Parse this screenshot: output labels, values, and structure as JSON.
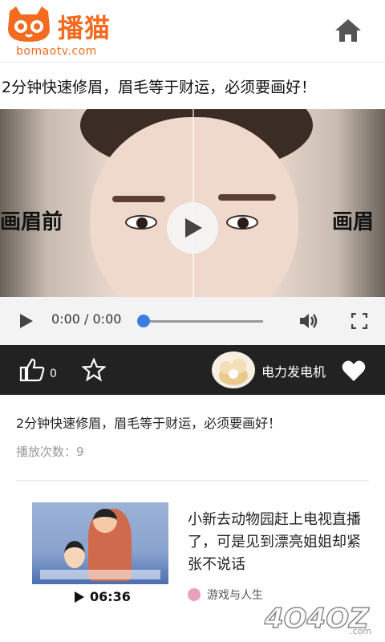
{
  "header": {
    "logo_cn": "播猫",
    "logo_url": "bomaotv.com",
    "home_icon": "home-icon"
  },
  "video": {
    "title": "2分钟快速修眉，眉毛等于财运，必须要画好！",
    "label_left": "画眉前",
    "label_right": "画眉",
    "controls": {
      "time": "0:00 / 0:00",
      "progress": 0
    }
  },
  "actions": {
    "like_count": "0",
    "channel_name": "电力发电机"
  },
  "info": {
    "description": "2分钟快速修眉，眉毛等于财运，必须要画好！",
    "play_count": "播放次数：9"
  },
  "recommend": [
    {
      "duration": "06:36",
      "title": "小新去动物园赶上电视直播了，可是见到漂亮姐姐却紧张不说话",
      "channel": "游戏与人生"
    }
  ],
  "watermark": "4O4OZ.com",
  "colors": {
    "brand": "#f26b1f",
    "bar": "#222222",
    "seek": "#3a7de0"
  }
}
